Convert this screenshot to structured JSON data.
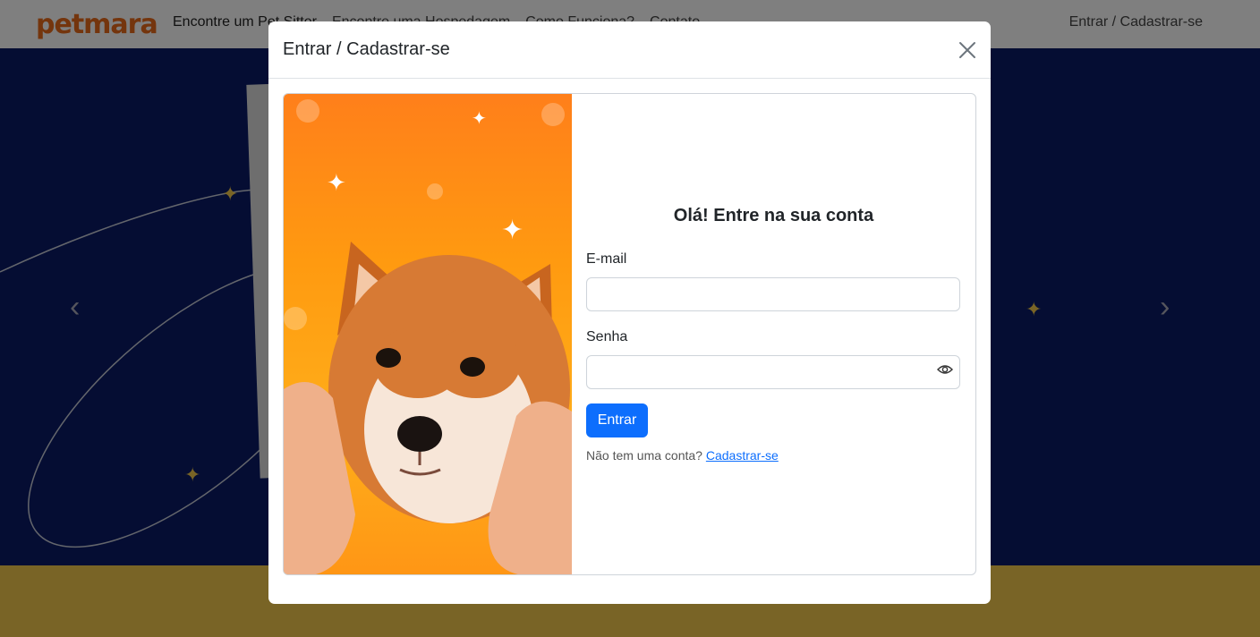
{
  "navbar": {
    "logo": "petmara",
    "links": [
      "Encontre um Pet Sitter",
      "Encontre uma Hospedagem",
      "Como Funciona?",
      "Contato"
    ],
    "auth_link": "Entrar / Cadastrar-se"
  },
  "modal": {
    "title": "Entrar / Cadastrar-se",
    "heading": "Olá! Entre na sua conta",
    "email_label": "E-mail",
    "email_value": "",
    "password_label": "Senha",
    "password_value": "",
    "submit_label": "Entrar",
    "signup_prompt": "Não tem uma conta?",
    "signup_link": "Cadastrar-se"
  },
  "colors": {
    "brand_orange": "#e96a1a",
    "hero_navy": "#0a1a66",
    "footer_yellow": "#f2c94c",
    "primary_blue": "#0d6efd"
  },
  "icons": {
    "close": "close-icon",
    "password_toggle": "eye-icon",
    "carousel_prev": "chevron-left-icon",
    "carousel_next": "chevron-right-icon"
  }
}
